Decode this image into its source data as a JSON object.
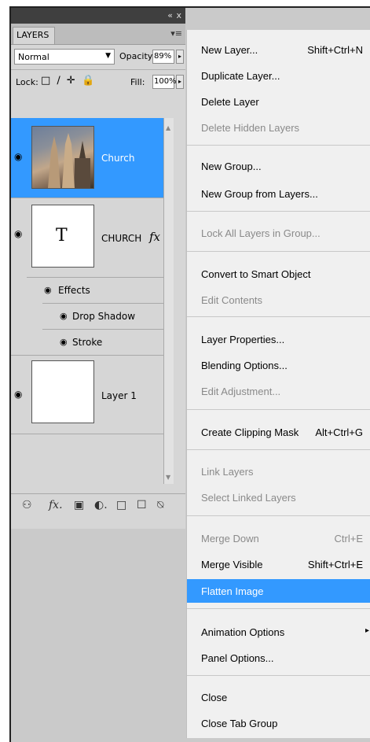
{
  "panel": {
    "tab_label": "LAYERS",
    "collapse_glyph": "«",
    "close_glyph": "x",
    "menu_icon": "▾≡",
    "blend_mode": "Normal",
    "opacity_label": "Opacity:",
    "opacity_value": "89%",
    "lock_label": "Lock:",
    "lock_icons": "□ ∕ ✛ 🔒",
    "fill_label": "Fill:",
    "fill_value": "100%",
    "layers": [
      {
        "name": "Church",
        "selected": true
      },
      {
        "name": "CHURCH",
        "thumb_text": "T",
        "fx": "fx"
      },
      {
        "name": "Layer 1"
      }
    ],
    "effects_label": "Effects",
    "effects": [
      "Drop Shadow",
      "Stroke"
    ],
    "bottom_icons": [
      "link-icon",
      "fx-icon",
      "mask-icon",
      "adjustment-icon",
      "group-icon",
      "new-layer-icon",
      "trash-icon"
    ],
    "bottom_glyphs": [
      "⚇",
      "fx.",
      "▣",
      "◐.",
      "□",
      "☐",
      "⍉"
    ]
  },
  "menu": {
    "items": [
      {
        "label": "New Layer...",
        "shortcut": "Shift+Ctrl+N",
        "disabled": false
      },
      {
        "label": "Duplicate Layer...",
        "disabled": false
      },
      {
        "label": "Delete Layer",
        "disabled": false
      },
      {
        "label": "Delete Hidden Layers",
        "disabled": true
      },
      {
        "label": "New Group...",
        "disabled": false
      },
      {
        "label": "New Group from Layers...",
        "disabled": false
      },
      {
        "label": "Lock All Layers in Group...",
        "disabled": true
      },
      {
        "label": "Convert to Smart Object",
        "disabled": false
      },
      {
        "label": "Edit Contents",
        "disabled": true
      },
      {
        "label": "Layer Properties...",
        "disabled": false
      },
      {
        "label": "Blending Options...",
        "disabled": false
      },
      {
        "label": "Edit Adjustment...",
        "disabled": true
      },
      {
        "label": "Create Clipping Mask",
        "shortcut": "Alt+Ctrl+G",
        "disabled": false
      },
      {
        "label": "Link Layers",
        "disabled": true
      },
      {
        "label": "Select Linked Layers",
        "disabled": true
      },
      {
        "label": "Merge Down",
        "shortcut": "Ctrl+E",
        "disabled": true
      },
      {
        "label": "Merge Visible",
        "shortcut": "Shift+Ctrl+E",
        "disabled": false
      },
      {
        "label": "Flatten Image",
        "disabled": false,
        "selected": true
      },
      {
        "label": "Animation Options",
        "disabled": false,
        "submenu_arrow": "▸"
      },
      {
        "label": "Panel Options...",
        "disabled": false
      },
      {
        "label": "Close",
        "disabled": false
      },
      {
        "label": "Close Tab Group",
        "disabled": false
      }
    ]
  },
  "colors": {
    "selection": "#3399ff",
    "panel_bg": "#d6d6d6",
    "menu_bg": "#f0f0f0",
    "disabled_text": "#8a8a8a"
  }
}
